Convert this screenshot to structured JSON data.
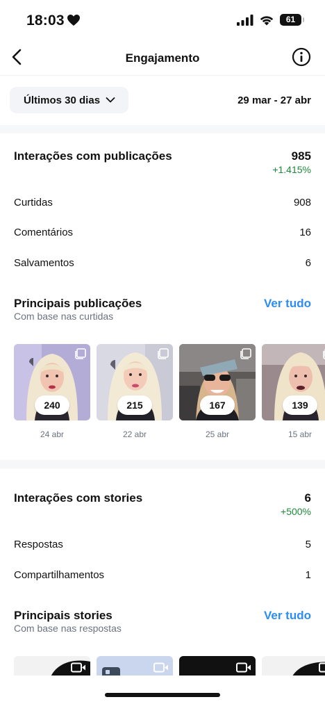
{
  "status_bar": {
    "time": "18:03",
    "battery": "61"
  },
  "nav": {
    "title": "Engajamento"
  },
  "filter": {
    "range_label": "Últimos 30 dias",
    "dates": "29 mar - 27 abr"
  },
  "post_interactions": {
    "title": "Interações com publicações",
    "total": "985",
    "delta": "+1.415%",
    "rows": [
      {
        "label": "Curtidas",
        "value": "908"
      },
      {
        "label": "Comentários",
        "value": "16"
      },
      {
        "label": "Salvamentos",
        "value": "6"
      }
    ]
  },
  "top_posts": {
    "title": "Principais publicações",
    "subtitle": "Com base nas curtidas",
    "see_all": "Ver tudo",
    "items": [
      {
        "count": "240",
        "date": "24 abr"
      },
      {
        "count": "215",
        "date": "22 abr"
      },
      {
        "count": "167",
        "date": "25 abr"
      },
      {
        "count": "139",
        "date": "15 abr"
      }
    ]
  },
  "story_interactions": {
    "title": "Interações com stories",
    "total": "6",
    "delta": "+500%",
    "rows": [
      {
        "label": "Respostas",
        "value": "5"
      },
      {
        "label": "Compartilhamentos",
        "value": "1"
      }
    ]
  },
  "top_stories": {
    "title": "Principais stories",
    "subtitle": "Com base nas respostas",
    "see_all": "Ver tudo"
  },
  "colors": {
    "positive": "#1b8a3a",
    "link": "#2b8cf5"
  }
}
